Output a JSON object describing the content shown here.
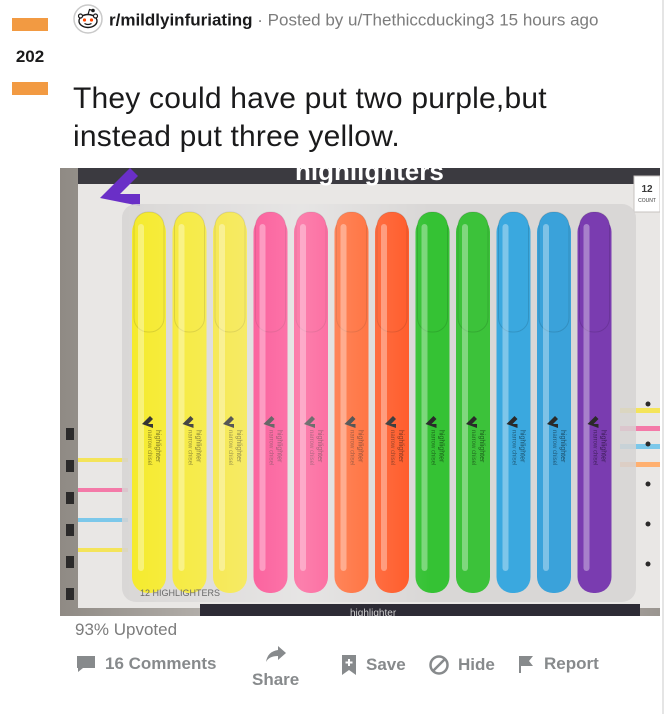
{
  "post": {
    "score": "202",
    "subreddit": "r/mildlyinfuriating",
    "separator": " · ",
    "posted_by": "Posted by u/Thethiccducking3 15 hours ago",
    "title": "They could have put two purple,but instead put three yellow.",
    "upvoted": "93% Upvoted"
  },
  "image": {
    "package_count": "12",
    "package_count_unit": "COUNT",
    "package_label": "12 HIGHLIGHTERS",
    "bottom_text": "highlighter",
    "header_text": "highlighters",
    "marker_text": "highlighter",
    "marker_subtext": "narrow chisel",
    "markers": [
      {
        "color": "#f5ea2a"
      },
      {
        "color": "#f5e82e"
      },
      {
        "color": "#f4e433"
      },
      {
        "color": "#fa2f7e"
      },
      {
        "color": "#fb3a80"
      },
      {
        "color": "#ff5a1f"
      },
      {
        "color": "#ff5420"
      },
      {
        "color": "#35c234"
      },
      {
        "color": "#3cc23a"
      },
      {
        "color": "#3aa8df"
      },
      {
        "color": "#3aa2da"
      },
      {
        "color": "#7a3cb0"
      }
    ]
  },
  "actions": {
    "comments": "16 Comments",
    "share": "Share",
    "save": "Save",
    "hide": "Hide",
    "report": "Report"
  },
  "colors": {
    "vote_accent": "#f29a42",
    "muted_text": "#7c7c7c",
    "action_text": "#878a8c"
  }
}
